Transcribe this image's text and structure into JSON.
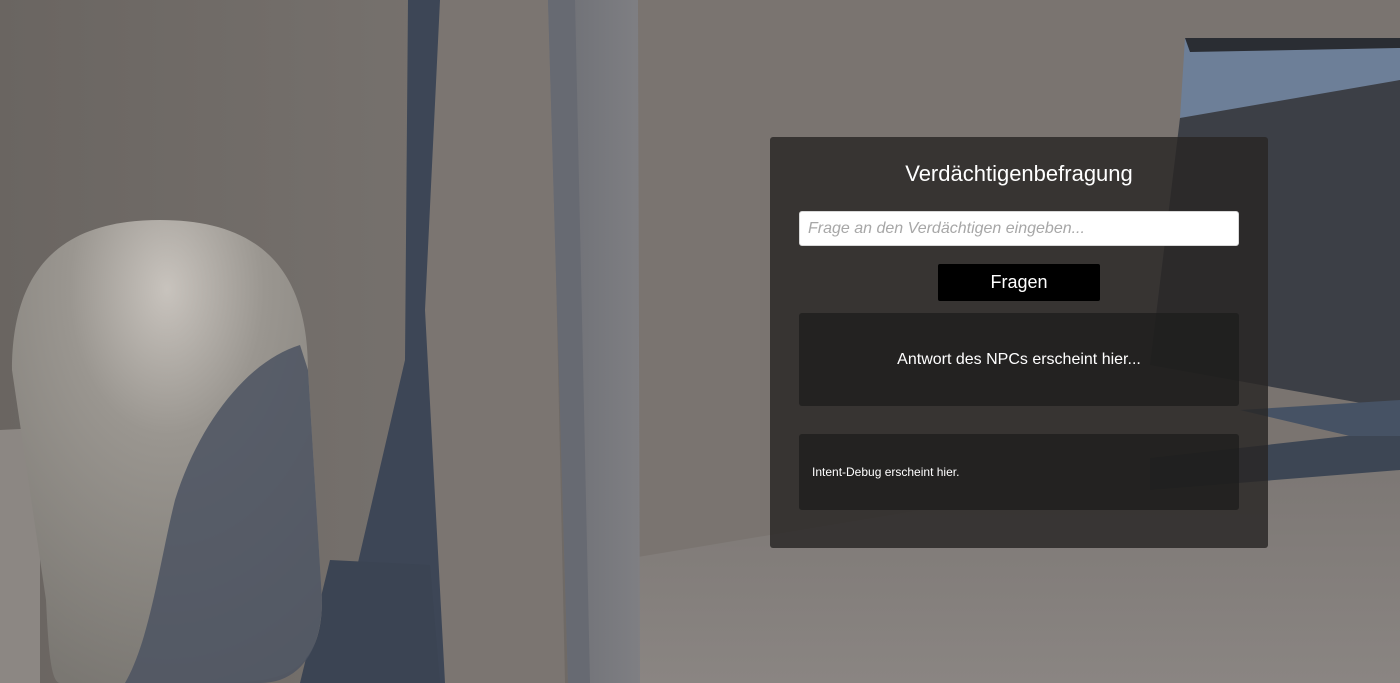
{
  "panel": {
    "title": "Verdächtigenbefragung",
    "input_placeholder": "Frage an den Verdächtigen eingeben...",
    "input_value": "",
    "ask_button_label": "Fragen",
    "answer_text": "Antwort des NPCs erscheint hier...",
    "debug_text": "Intent-Debug erscheint hier."
  },
  "colors": {
    "panel_background": "#282624",
    "button_background": "#000000",
    "text": "#ffffff",
    "placeholder": "#a7a7a7"
  },
  "scene": {
    "objects": [
      "capsule",
      "pillar",
      "walls",
      "floor",
      "sky"
    ]
  }
}
